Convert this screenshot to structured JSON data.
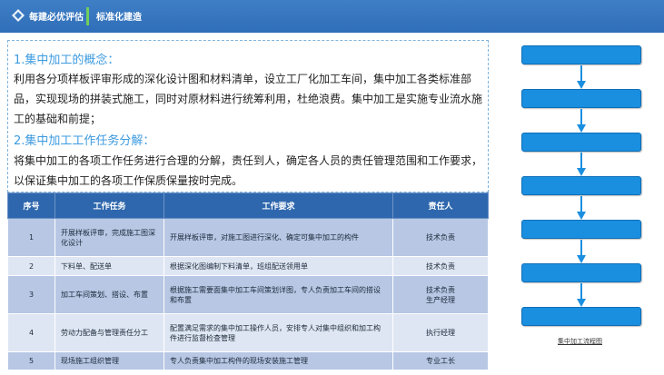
{
  "header": {
    "brand": "每建必优评估",
    "subtitle": "标准化建造",
    "accent_color": "#6fcf5a",
    "bar_color": "#3a7bc4"
  },
  "text": {
    "heading1": "1.集中加工的概念：",
    "para1": "利用各分项样板评审形成的深化设计图和材料清单，设立工厂化加工车间，集中加工各类标准部品，实现现场的拼装式施工，同时对原材料进行统筹利用，杜绝浪费。集中加工是实施专业流水施工的基础和前提；",
    "heading2": "2.集中加工工作任务分解：",
    "para2": "将集中加工的各项工作任务进行合理的分解，责任到人，确定各人员的责任管理范围和工作要求，以保证集中加工的各项工作保质保量按时完成。"
  },
  "table": {
    "headers": [
      "序号",
      "工作任务",
      "工作要求",
      "责任人"
    ],
    "rows": [
      {
        "num": "1",
        "task": "开展样板评审，完成施工图深化设计",
        "req": "开展样板评审，对施工图进行深化、确定可集中加工的构件",
        "owner": "技术负责"
      },
      {
        "num": "2",
        "task": "下料单、配送单",
        "req": "根据深化图编制下料清单，班组配送领用单",
        "owner": "技术负责"
      },
      {
        "num": "3",
        "task": "加工车间策划、搭设、布置",
        "req": "根据施工需要面集中加工车间策划详图，专人负责加工车间的搭设和布置",
        "owner": "技术负责\n生产经理"
      },
      {
        "num": "4",
        "task": "劳动力配备与管理责任分工",
        "req": "配置满足需求的集中加工操作人员，安排专人对集中组织和加工构件进行监督检查管理",
        "owner": "执行经理"
      },
      {
        "num": "5",
        "task": "现场施工组织管理",
        "req": "专人负责集中加工构件的现场安装施工管理",
        "owner": "专业工长"
      }
    ]
  },
  "flow": {
    "steps": 7,
    "box_color": "#1a8fe0",
    "arrow_color": "#1a8fe0",
    "caption": "集中加工流程图"
  }
}
